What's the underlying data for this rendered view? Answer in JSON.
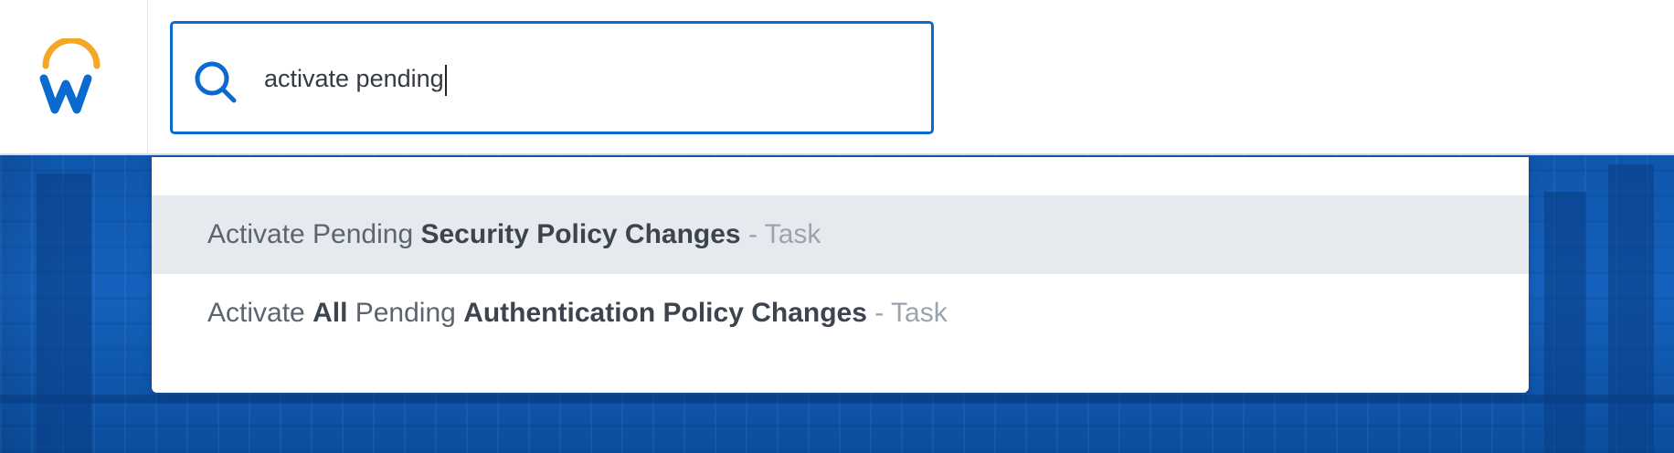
{
  "search": {
    "value": "activate pending"
  },
  "results": [
    {
      "parts": [
        {
          "text": "Activate Pending ",
          "bold": false
        },
        {
          "text": "Security Policy Changes",
          "bold": true
        }
      ],
      "suffix": " - Task",
      "highlighted": true
    },
    {
      "parts": [
        {
          "text": "Activate ",
          "bold": false
        },
        {
          "text": "All",
          "bold": true
        },
        {
          "text": " Pending ",
          "bold": false
        },
        {
          "text": "Authentication Policy Changes",
          "bold": true
        }
      ],
      "suffix": " - Task",
      "highlighted": false
    }
  ],
  "icons": {
    "logo": "workday-logo",
    "search": "search-icon"
  },
  "colors": {
    "accent": "#0a6ad0",
    "logo_arc": "#f5a623",
    "logo_w": "#0a6ad0",
    "highlight": "#e6eaee"
  }
}
